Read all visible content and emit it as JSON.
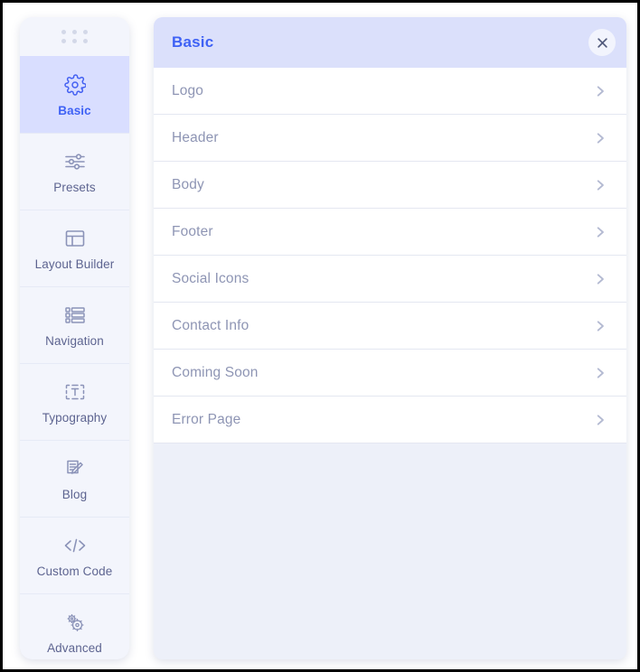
{
  "sidebar": {
    "drag_handle_icon": "grid-dots-icon",
    "items": [
      {
        "label": "Basic",
        "icon": "gear-icon",
        "active": true
      },
      {
        "label": "Presets",
        "icon": "sliders-icon",
        "active": false
      },
      {
        "label": "Layout Builder",
        "icon": "layout-icon",
        "active": false
      },
      {
        "label": "Navigation",
        "icon": "list-icon",
        "active": false
      },
      {
        "label": "Typography",
        "icon": "text-box-icon",
        "active": false
      },
      {
        "label": "Blog",
        "icon": "document-pencil-icon",
        "active": false
      },
      {
        "label": "Custom Code",
        "icon": "code-brackets-icon",
        "active": false
      },
      {
        "label": "Advanced",
        "icon": "double-gear-icon",
        "active": false
      }
    ]
  },
  "panel": {
    "title": "Basic",
    "close_icon": "close-icon",
    "row_chevron_icon": "chevron-right-icon",
    "rows": [
      {
        "label": "Logo"
      },
      {
        "label": "Header"
      },
      {
        "label": "Body"
      },
      {
        "label": "Footer"
      },
      {
        "label": "Social Icons"
      },
      {
        "label": "Contact Info"
      },
      {
        "label": "Coming Soon"
      },
      {
        "label": "Error Page"
      }
    ]
  },
  "colors": {
    "accent_blue": "#3f62f5",
    "active_item_bg": "#d9deff",
    "header_bg": "#dbe0fb",
    "sidebar_bg": "#f3f5fc",
    "panel_bg": "#edf0f9",
    "row_bg": "#ffffff",
    "row_label": "#8e95b4",
    "icon_muted": "#8b93b8"
  }
}
